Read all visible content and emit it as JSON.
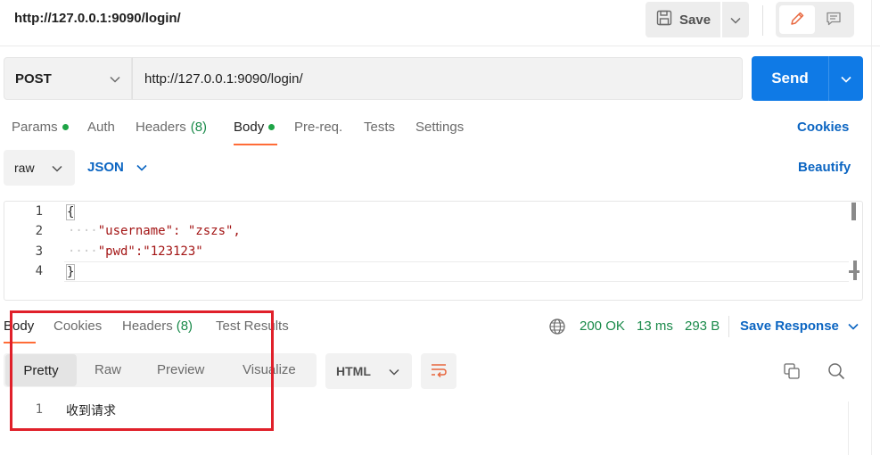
{
  "header": {
    "title": "http://127.0.0.1:9090/login/",
    "save_label": "Save"
  },
  "request": {
    "method": "POST",
    "url": "http://127.0.0.1:9090/login/",
    "send_label": "Send"
  },
  "request_tabs": [
    {
      "label": "Params",
      "dot": true
    },
    {
      "label": "Auth"
    },
    {
      "label": "Headers",
      "count": "(8)"
    },
    {
      "label": "Body",
      "dot": true,
      "active": true
    },
    {
      "label": "Pre-req."
    },
    {
      "label": "Tests"
    },
    {
      "label": "Settings"
    }
  ],
  "cookies_link": "Cookies",
  "body_options": {
    "mode": "raw",
    "language": "JSON",
    "beautify_label": "Beautify"
  },
  "request_body": {
    "line_numbers": [
      "1",
      "2",
      "3",
      "4"
    ],
    "lines": [
      "{",
      "\"username\": \"zszs\",",
      "\"pwd\":\"123123\"",
      "}"
    ]
  },
  "response_tabs": [
    {
      "label": "Body",
      "active": true
    },
    {
      "label": "Cookies"
    },
    {
      "label": "Headers",
      "count": "(8)"
    },
    {
      "label": "Test Results"
    }
  ],
  "response_status": {
    "status": "200 OK",
    "time": "13 ms",
    "size": "293 B",
    "save_response_label": "Save Response"
  },
  "response_view": {
    "modes": [
      "Pretty",
      "Raw",
      "Preview",
      "Visualize"
    ],
    "active_mode": "Pretty",
    "format": "HTML"
  },
  "response_body": {
    "line_number": "1",
    "text": "收到请求"
  },
  "colors": {
    "accent": "#0f7ae6",
    "tab_indicator": "#ff6c37",
    "status_ok": "#1a8a4a",
    "annotation_box": "#e0202a"
  },
  "icons": [
    "save-icon",
    "chevron-down-icon",
    "pencil-icon",
    "comment-icon",
    "globe-icon",
    "wrap-lines-icon",
    "copy-icon",
    "search-icon"
  ]
}
